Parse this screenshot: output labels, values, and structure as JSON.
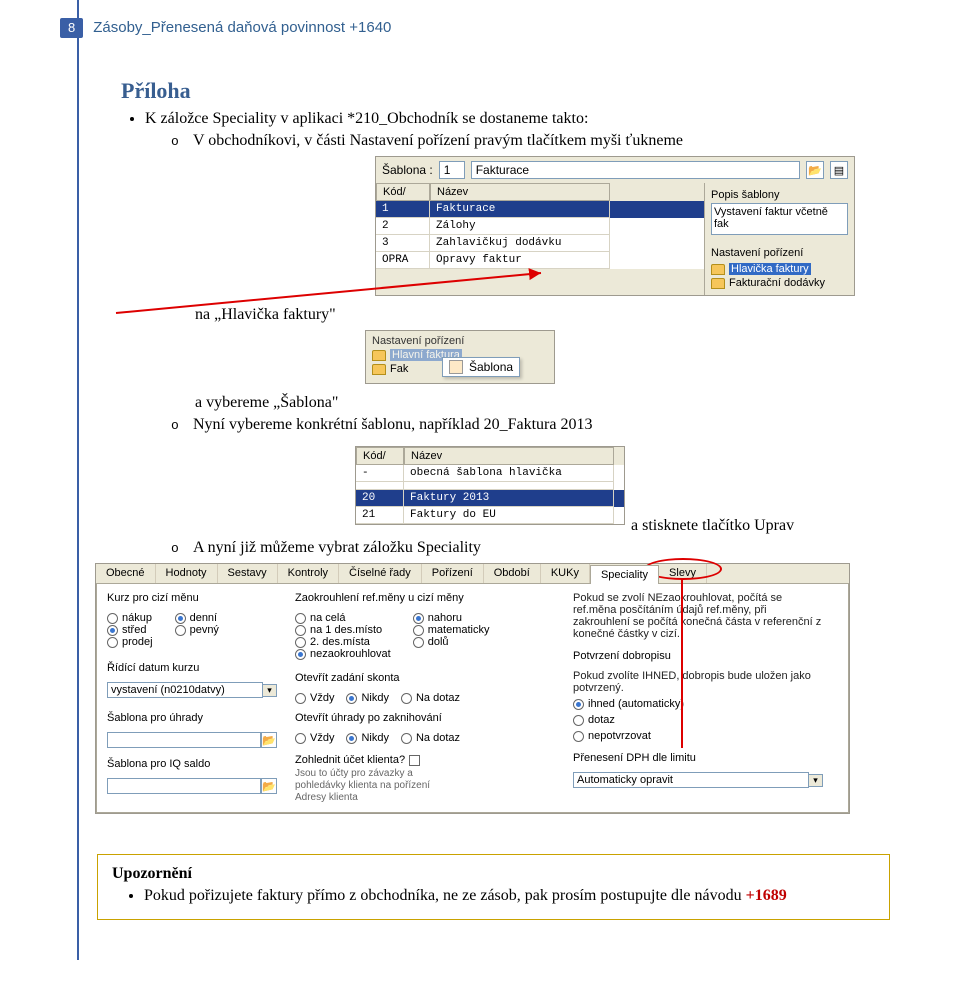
{
  "header": {
    "page_number": "8",
    "title": "Zásoby_Přenesená daňová povinnost +1640"
  },
  "section": {
    "heading": "Příloha"
  },
  "bullets": {
    "b1": "K záložce Speciality v aplikaci *210_Obchodník se dostaneme takto:",
    "b1a": "V obchodníkovi, v části Nastavení pořízení pravým tlačítkem myši ťukneme",
    "b1b_prefix": "na „Hlavička faktury\"",
    "b2_prefix": "a vybereme „Šablona\"",
    "b2a": "Nyní vybereme konkrétní šablonu, například 20_Faktura 2013",
    "b2_press": "a stisknete tlačítko Uprav",
    "b3": "A nyní již můžeme vybrat záložku Speciality"
  },
  "shot1": {
    "label_sablona": "Šablona :",
    "code_value": "1",
    "name_value": "Fakturace",
    "headers": {
      "c1": "Kód/",
      "c2": "Název"
    },
    "rows": [
      {
        "code": "1",
        "name": "Fakturace",
        "selected": true
      },
      {
        "code": "2",
        "name": "Zálohy",
        "selected": false
      },
      {
        "code": "3",
        "name": "Zahlavičkuj dodávku",
        "selected": false
      },
      {
        "code": "OPRA",
        "name": "Opravy faktur",
        "selected": false
      }
    ],
    "right": {
      "title": "Popis šablony",
      "desc": "Vystavení faktur včetně fak",
      "group": "Nastavení pořízení",
      "item1": "Hlavička faktury",
      "item2": "Fakturační dodávky"
    }
  },
  "shot2": {
    "title": "Nastavení pořízení",
    "item_dim1": "Hlavní faktura",
    "item_fak": "Fak",
    "item_sel": "Šablona"
  },
  "shot3": {
    "headers": {
      "c1": "Kód/",
      "c2": "Název"
    },
    "rows": [
      {
        "code": "-",
        "name": "obecná šablona hlavička",
        "selected": false
      },
      {
        "code": "20",
        "name": "Faktury 2013",
        "selected": true
      },
      {
        "code": "21",
        "name": "Faktury do EU",
        "selected": false
      }
    ]
  },
  "shot4": {
    "tabs": [
      "Obecné",
      "Hodnoty",
      "Sestavy",
      "Kontroly",
      "Číselné řady",
      "Pořízení",
      "Období",
      "KUKy",
      "Speciality",
      "Slevy"
    ],
    "active_tab_index": 8,
    "col1": {
      "h": "Kurz pro cizí měnu",
      "opts": [
        "nákup",
        "střed",
        "prodej"
      ],
      "sel": 1,
      "h2": "Řídící datum kurzu",
      "field": "vystavení (n0210datvy)",
      "h3": "Šablona pro úhrady",
      "h4": "Šablona pro IQ saldo"
    },
    "col2": {
      "opts": [
        "denní",
        "pevný"
      ],
      "sel": 0
    },
    "col3": {
      "h": "Zaokrouhlení ref.měny u cizí měny",
      "opts": [
        "na celá",
        "na 1 des.místo",
        "2. des.místa",
        "nezaokrouhlovat"
      ],
      "sel": 3,
      "h2": "Otevřít zadání skonta",
      "row2": [
        "Vždy",
        "Nikdy",
        "Na dotaz"
      ],
      "row2sel": 1,
      "h3": "Otevřít úhrady po zaknihování",
      "row3": [
        "Vždy",
        "Nikdy",
        "Na dotaz"
      ],
      "row3sel": 1,
      "h4": "Zohlednit účet klienta?",
      "note": "Jsou to účty pro závazky a pohledávky klienta na pořízení Adresy klienta"
    },
    "col4": {
      "opts": [
        "nahoru",
        "matematicky",
        "dolů"
      ],
      "sel": 0
    },
    "col5": {
      "tip1": "Pokud se zvolí NEzaokrouhlovat, počítá se ref.měna posčítáním údajů ref.měny, při zakrouhlení se počítá konečná částa v referenční z konečné částky v cizí.",
      "h2": "Potvrzení dobropisu",
      "tip2": "Pokud zvolíte IHNED, dobropis bude uložen jako potvrzený.",
      "opts": [
        "ihned (automaticky)",
        "dotaz",
        "nepotvrzovat"
      ],
      "sel": 0,
      "h3": "Přenesení DPH dle limitu",
      "field": "Automaticky opravit"
    }
  },
  "notice": {
    "title": "Upozornění",
    "text_prefix": "Pokud pořizujete faktury přímo z obchodníka, ne ze zásob, pak prosím postupujte dle návodu ",
    "link": "+1689"
  }
}
